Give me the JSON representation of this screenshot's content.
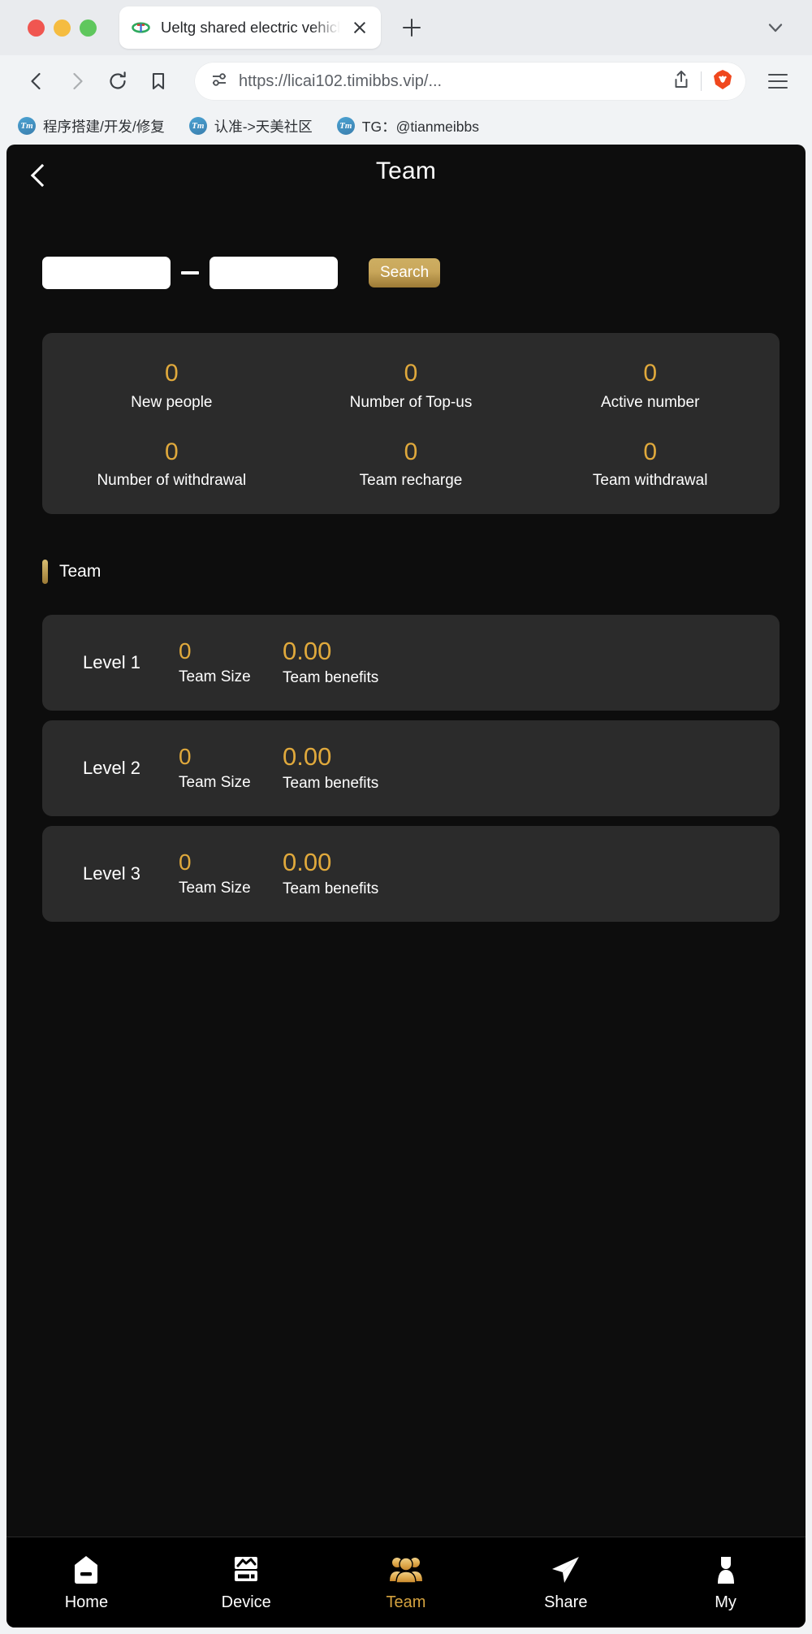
{
  "browser": {
    "tab": {
      "title": "Ueltg shared electric vehicles",
      "favicon_name": "site-favicon",
      "close_label": "Close tab"
    },
    "new_tab_label": "New tab",
    "tab_list_label": "Search tabs",
    "nav": {
      "back_label": "Back",
      "forward_label": "Forward",
      "reload_label": "Reload",
      "bookmark_label": "Bookmark this page"
    },
    "url": "https://licai102.timibbs.vip/...",
    "share_label": "Share",
    "brave_label": "Brave Rewards",
    "menu_label": "Customize and control Brave",
    "bookmarks": [
      {
        "icon_text": "Tm",
        "label": "程序搭建/开发/修复"
      },
      {
        "icon_text": "Tm",
        "label": "认准->天美社区"
      },
      {
        "icon_text": "Tm",
        "label": "TG：@tianmeibbs"
      }
    ]
  },
  "page": {
    "header": {
      "back_label": "Back",
      "title": "Team"
    },
    "search": {
      "start_value": "",
      "start_placeholder": "",
      "separator": "—",
      "end_value": "",
      "end_placeholder": "",
      "button_label": "Search"
    },
    "stats": [
      {
        "value": "0",
        "label": "New people"
      },
      {
        "value": "0",
        "label": "Number of Top-us"
      },
      {
        "value": "0",
        "label": "Active number"
      },
      {
        "value": "0",
        "label": "Number of withdrawal"
      },
      {
        "value": "0",
        "label": "Team recharge"
      },
      {
        "value": "0",
        "label": "Team withdrawal"
      }
    ],
    "section_title": "Team",
    "levels": [
      {
        "name": "Level 1",
        "size_value": "0",
        "size_label": "Team Size",
        "benefit_value": "0.00",
        "benefit_label": "Team benefits"
      },
      {
        "name": "Level 2",
        "size_value": "0",
        "size_label": "Team Size",
        "benefit_value": "0.00",
        "benefit_label": "Team benefits"
      },
      {
        "name": "Level 3",
        "size_value": "0",
        "size_label": "Team Size",
        "benefit_value": "0.00",
        "benefit_label": "Team benefits"
      }
    ],
    "tabbar": [
      {
        "label": "Home",
        "icon": "home-icon",
        "active": false
      },
      {
        "label": "Device",
        "icon": "device-icon",
        "active": false
      },
      {
        "label": "Team",
        "icon": "team-icon",
        "active": true
      },
      {
        "label": "Share",
        "icon": "share-icon",
        "active": false
      },
      {
        "label": "My",
        "icon": "person-icon",
        "active": false
      }
    ]
  },
  "colors": {
    "page_background": "#0d0d0d",
    "card_background": "#2b2b2b",
    "accent_gold": "#e0a93c",
    "accent_gold_dark": "#9c7a35",
    "text_primary": "#ffffff"
  }
}
